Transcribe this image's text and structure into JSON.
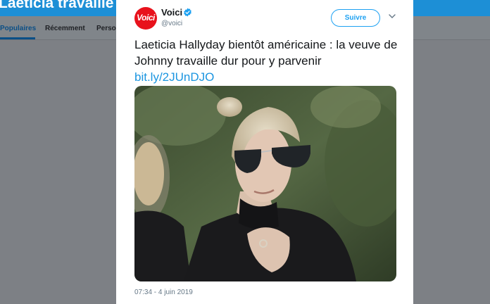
{
  "background": {
    "header_title": "Laeticia travaille dur",
    "tabs": [
      "Populaires",
      "Récemment",
      "Perso"
    ]
  },
  "tweet": {
    "account_name": "Voici",
    "handle": "@voici",
    "avatar_text": "Voici",
    "follow_label": "Suivre",
    "text": "Laeticia Hallyday bientôt américaine : la veuve de Johnny travaille dur pour y parvenir",
    "link": "bit.ly/2JUnDJO",
    "timestamp": "07:34 - 4 juin 2019"
  },
  "colors": {
    "accent": "#1da1f2",
    "link": "#1b95e0",
    "brand": "#e8121c",
    "header": "#1d8fd6"
  },
  "icons": {
    "verified": "verified-badge-icon",
    "caret": "chevron-down-icon"
  }
}
